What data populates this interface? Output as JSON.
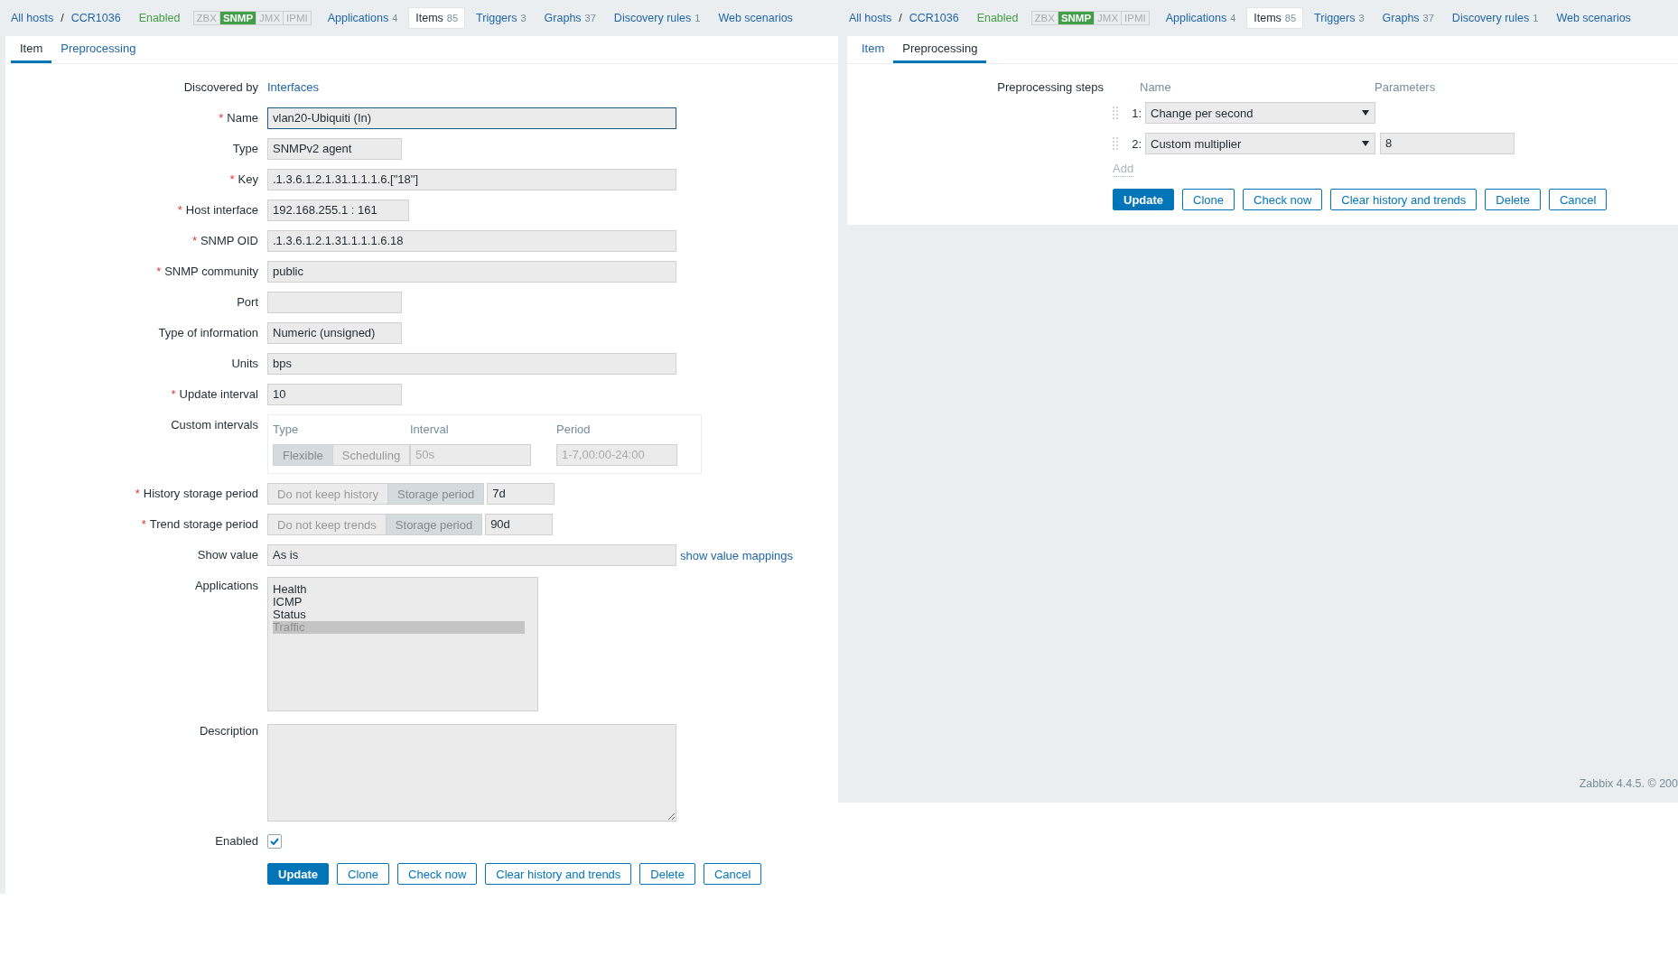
{
  "item_screen": {
    "nav": {
      "breadcrumbs": [
        "All hosts",
        "CCR1036"
      ],
      "separator": "/",
      "status": "Enabled",
      "interfaces": [
        {
          "label": "ZBX",
          "active": false
        },
        {
          "label": "SNMP",
          "active": true
        },
        {
          "label": "JMX",
          "active": false
        },
        {
          "label": "IPMI",
          "active": false
        }
      ],
      "tabs": [
        {
          "label": "Applications",
          "count": "4",
          "selected": false
        },
        {
          "label": "Items",
          "count": "85",
          "selected": true
        },
        {
          "label": "Triggers",
          "count": "3",
          "selected": false
        },
        {
          "label": "Graphs",
          "count": "37",
          "selected": false
        },
        {
          "label": "Discovery rules",
          "count": "1",
          "selected": false
        },
        {
          "label": "Web scenarios",
          "selected": false
        }
      ]
    },
    "form_tabs": [
      {
        "label": "Item",
        "selected": true
      },
      {
        "label": "Preprocessing",
        "selected": false
      }
    ],
    "rows": [
      {
        "kind": "link",
        "label": "Discovered by",
        "value": "Interfaces"
      },
      {
        "kind": "input",
        "label": "Name",
        "required_mark": "*",
        "focused": true,
        "value": "vlan20-Ubiquiti (In)"
      },
      {
        "kind": "input",
        "label": "Type",
        "value": "SNMPv2 agent"
      },
      {
        "kind": "input",
        "label": "Key",
        "required_mark": "*",
        "value": ".1.3.6.1.2.1.31.1.1.1.6.[\"18\"]"
      },
      {
        "kind": "input",
        "label": "Host interface",
        "required_mark": "*",
        "value": "192.168.255.1 : 161"
      },
      {
        "kind": "input",
        "label": "SNMP OID",
        "required_mark": "*",
        "value": ".1.3.6.1.2.1.31.1.1.1.6.18"
      },
      {
        "kind": "input",
        "label": "SNMP community",
        "required_mark": "*",
        "value": "public"
      },
      {
        "kind": "input",
        "label": "Port"
      },
      {
        "kind": "input",
        "label": "Type of information",
        "value": "Numeric (unsigned)"
      },
      {
        "kind": "input",
        "label": "Units",
        "value": "bps"
      },
      {
        "kind": "input",
        "label": "Update interval",
        "required_mark": "*",
        "value": "10"
      },
      {
        "kind": "intervals",
        "label": "Custom intervals",
        "columns": [
          "Type",
          "Interval",
          "Period"
        ],
        "segments": [
          {
            "label": "Flexible",
            "selected": true
          },
          {
            "label": "Scheduling",
            "selected": false
          }
        ],
        "interval_placeholder": "50s",
        "period_placeholder": "1-7,00:00-24:00"
      },
      {
        "kind": "storage",
        "label": "History storage period",
        "required_mark": "*",
        "segments": [
          {
            "label": "Do not keep history",
            "selected": false
          },
          {
            "label": "Storage period",
            "selected": true
          }
        ],
        "value": "7d"
      },
      {
        "kind": "storage",
        "label": "Trend storage period",
        "required_mark": "*",
        "segments": [
          {
            "label": "Do not keep trends",
            "selected": false
          },
          {
            "label": "Storage period",
            "selected": true
          }
        ],
        "value": "90d"
      },
      {
        "kind": "input",
        "label": "Show value",
        "value": "As is",
        "link": "show value mappings"
      },
      {
        "kind": "listbox",
        "label": "Applications",
        "options": [
          {
            "label": "Health",
            "selected": false
          },
          {
            "label": "ICMP",
            "selected": false
          },
          {
            "label": "Status",
            "selected": false
          },
          {
            "label": "Traffic",
            "selected": true
          }
        ]
      },
      {
        "kind": "textarea",
        "label": "Description"
      },
      {
        "kind": "checkbox",
        "label": "Enabled",
        "checked": true
      }
    ],
    "buttons": [
      {
        "label": "Update",
        "kind": "primary"
      },
      {
        "label": "Clone",
        "kind": "secondary"
      },
      {
        "label": "Check now",
        "kind": "secondary"
      },
      {
        "label": "Clear history and trends",
        "kind": "secondary"
      },
      {
        "label": "Delete",
        "kind": "secondary"
      },
      {
        "label": "Cancel",
        "kind": "secondary"
      }
    ]
  },
  "preprocessing_screen": {
    "nav": {
      "breadcrumbs": [
        "All hosts",
        "CCR1036"
      ],
      "separator": "/",
      "status": "Enabled",
      "interfaces": [
        {
          "label": "ZBX",
          "active": false
        },
        {
          "label": "SNMP",
          "active": true
        },
        {
          "label": "JMX",
          "active": false
        },
        {
          "label": "IPMI",
          "active": false
        }
      ],
      "tabs": [
        {
          "label": "Applications",
          "count": "4",
          "selected": false
        },
        {
          "label": "Items",
          "count": "85",
          "selected": true
        },
        {
          "label": "Triggers",
          "count": "3",
          "selected": false
        },
        {
          "label": "Graphs",
          "count": "37",
          "selected": false
        },
        {
          "label": "Discovery rules",
          "count": "1",
          "selected": false
        },
        {
          "label": "Web scenarios",
          "selected": false
        }
      ]
    },
    "form_tabs": [
      {
        "label": "Item",
        "selected": false
      },
      {
        "label": "Preprocessing",
        "selected": true
      }
    ],
    "steps_label": "Preprocessing steps",
    "columns": [
      "Name",
      "Parameters"
    ],
    "steps": [
      {
        "number": "1:",
        "name": "Change per second"
      },
      {
        "number": "2:",
        "name": "Custom multiplier",
        "parameter": "8"
      }
    ],
    "add_link": "Add",
    "buttons": [
      {
        "label": "Update",
        "kind": "primary"
      },
      {
        "label": "Clone",
        "kind": "secondary"
      },
      {
        "label": "Check now",
        "kind": "secondary"
      },
      {
        "label": "Clear history and trends",
        "kind": "secondary"
      },
      {
        "label": "Delete",
        "kind": "secondary"
      },
      {
        "label": "Cancel",
        "kind": "secondary"
      }
    ],
    "footer": "Zabbix 4.4.5. © 200"
  }
}
